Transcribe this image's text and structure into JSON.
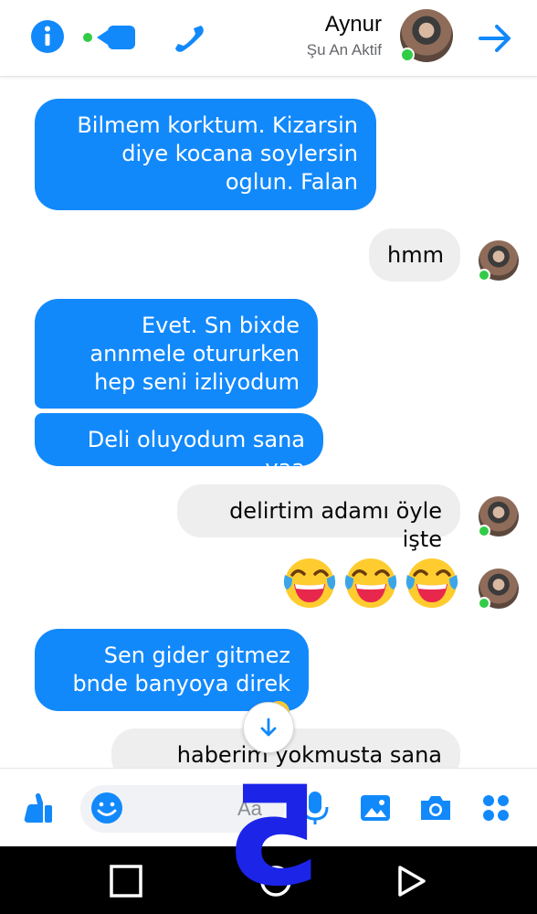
{
  "header": {
    "contact_name": "Aynur",
    "status": "Şu An Aktif"
  },
  "messages": [
    {
      "side": "left",
      "color": "blue",
      "text": "Bilmem korktum. Kizarsin diye kocana soylersin oglun. Falan"
    },
    {
      "side": "right",
      "color": "gray",
      "text": "hmm"
    },
    {
      "side": "left",
      "color": "blue",
      "text": "Evet. Sn bixde annmele otururken hep seni izliyodum"
    },
    {
      "side": "left",
      "color": "blue",
      "text": "Deli oluyodum sana yaa"
    },
    {
      "side": "right",
      "color": "gray",
      "text": "delirtim adamı öyle işte"
    },
    {
      "side": "right",
      "type": "emoji",
      "count": 3,
      "emoji": "face-with-tears-of-joy"
    },
    {
      "side": "left",
      "color": "blue",
      "text": "Sen gider gitmez bnde banyoya direk"
    },
    {
      "side": "right",
      "color": "gray",
      "text": "haberim yokmusta sana neler"
    }
  ],
  "composer": {
    "placeholder": "Aa"
  },
  "overlay": {
    "label": "5"
  },
  "colors": {
    "accent": "#1289fb",
    "online": "#31cc46",
    "bubble_gray": "#eeeeee",
    "overlay": "#1c24e8"
  }
}
